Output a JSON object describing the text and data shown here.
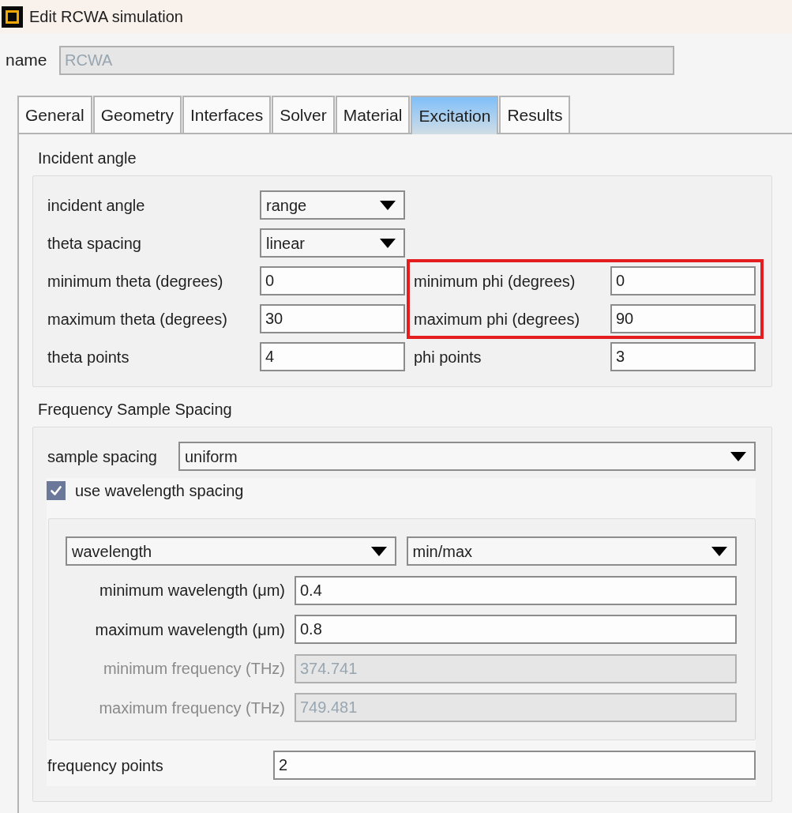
{
  "window": {
    "title": "Edit RCWA simulation"
  },
  "name_field": {
    "label": "name",
    "value": "RCWA",
    "disabled": true
  },
  "tabs": [
    {
      "label": "General",
      "selected": false
    },
    {
      "label": "Geometry",
      "selected": false
    },
    {
      "label": "Interfaces",
      "selected": false
    },
    {
      "label": "Solver",
      "selected": false
    },
    {
      "label": "Material",
      "selected": false
    },
    {
      "label": "Excitation",
      "selected": true
    },
    {
      "label": "Results",
      "selected": false
    }
  ],
  "incident_angle": {
    "heading": "Incident angle",
    "fields": [
      {
        "label": "incident angle",
        "kind": "select",
        "value": "range"
      },
      {
        "label": "theta spacing",
        "kind": "select",
        "value": "linear"
      },
      {
        "label": "minimum theta (degrees)",
        "kind": "input",
        "value": "0"
      },
      {
        "label": "maximum theta (degrees)",
        "kind": "input",
        "value": "30"
      },
      {
        "label": "theta points",
        "kind": "input",
        "value": "4"
      }
    ],
    "phi_fields": [
      {
        "label": "minimum phi (degrees)",
        "kind": "input",
        "value": "0",
        "highlighted": true
      },
      {
        "label": "maximum phi (degrees)",
        "kind": "input",
        "value": "90",
        "highlighted": true
      },
      {
        "label": "phi points",
        "kind": "input",
        "value": "3",
        "highlighted": false
      }
    ]
  },
  "frequency_sample_spacing": {
    "heading": "Frequency Sample Spacing",
    "sample_spacing": {
      "label": "sample spacing",
      "value": "uniform"
    },
    "use_wavelength_spacing": {
      "label": "use wavelength spacing",
      "checked": true
    },
    "range_selects": [
      {
        "value": "wavelength"
      },
      {
        "value": "min/max"
      }
    ],
    "range_fields": [
      {
        "label": "minimum wavelength (μm)",
        "value": "0.4",
        "disabled": false
      },
      {
        "label": "maximum wavelength (μm)",
        "value": "0.8",
        "disabled": false
      },
      {
        "label": "minimum frequency (THz)",
        "value": "374.741",
        "disabled": true
      },
      {
        "label": "maximum frequency (THz)",
        "value": "749.481",
        "disabled": true
      }
    ],
    "frequency_points": {
      "label": "frequency points",
      "value": "2"
    }
  }
}
